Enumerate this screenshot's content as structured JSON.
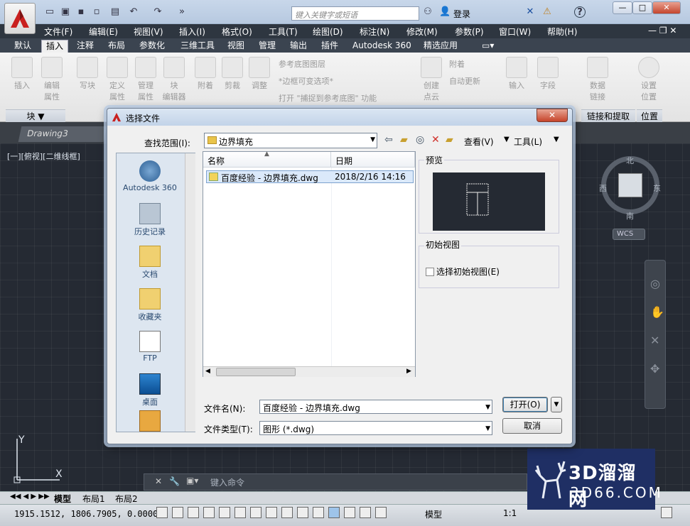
{
  "app": {
    "search_placeholder": "键入关键字或短语",
    "login": "登录",
    "help": "?",
    "menus": [
      "文件(F)",
      "编辑(E)",
      "视图(V)",
      "插入(I)",
      "格式(O)",
      "工具(T)",
      "绘图(D)",
      "标注(N)",
      "修改(M)",
      "参数(P)",
      "窗口(W)",
      "帮助(H)"
    ],
    "ribbon_tabs": [
      "默认",
      "插入",
      "注释",
      "布局",
      "参数化",
      "三维工具",
      "视图",
      "管理",
      "输出",
      "插件",
      "Autodesk 360",
      "精选应用"
    ],
    "active_tab": "插入",
    "ribbon_buttons": [
      "插入",
      "编辑\n属性",
      "写块",
      "定义\n属性",
      "管理\n属性",
      "块\n编辑器",
      "附着",
      "剪裁",
      "调整",
      "创建\n点云",
      "输入",
      "字段",
      "数据\n链接",
      "设置\n位置"
    ],
    "ribbon_small": [
      "参考底图图层",
      "*边框可变选项*",
      "打开 \"捕捉到参考底图\" 功能",
      "附着",
      "自动更新"
    ],
    "panel_labels": {
      "block": "块 ▼",
      "link": "链接和提取",
      "location": "位置"
    },
    "document_tab": "Drawing3",
    "view_label": "[一][俯视][二维线框]",
    "compass": {
      "n": "北",
      "s": "南",
      "e": "东",
      "w": "西"
    },
    "wcs": "WCS",
    "cmd_placeholder": "键入命令",
    "layout_tabs": [
      "模型",
      "布局1",
      "布局2"
    ],
    "coords": "1915.1512, 1806.7905, 0.0000",
    "status_model": "模型",
    "scale": "1:1",
    "watermark": {
      "title": "3D溜溜网",
      "url": "3D66.COM"
    }
  },
  "dialog": {
    "title": "选择文件",
    "lookin_label": "查找范围(I):",
    "lookin_value": "边界填充",
    "view_menu": "查看(V)",
    "tools_menu": "工具(L)",
    "places": [
      "Autodesk 360",
      "历史记录",
      "文档",
      "收藏夹",
      "FTP",
      "桌面"
    ],
    "columns": [
      "名称",
      "日期"
    ],
    "files": [
      {
        "name": "百度经验 - 边界填充.dwg",
        "date": "2018/2/16 14:16"
      }
    ],
    "preview_label": "预览",
    "initial_view_label": "初始视图",
    "initial_view_check": "选择初始视图(E)",
    "filename_label": "文件名(N):",
    "filename_value": "百度经验 - 边界填充.dwg",
    "filetype_label": "文件类型(T):",
    "filetype_value": "图形 (*.dwg)",
    "open_button": "打开(O)",
    "cancel_button": "取消"
  }
}
